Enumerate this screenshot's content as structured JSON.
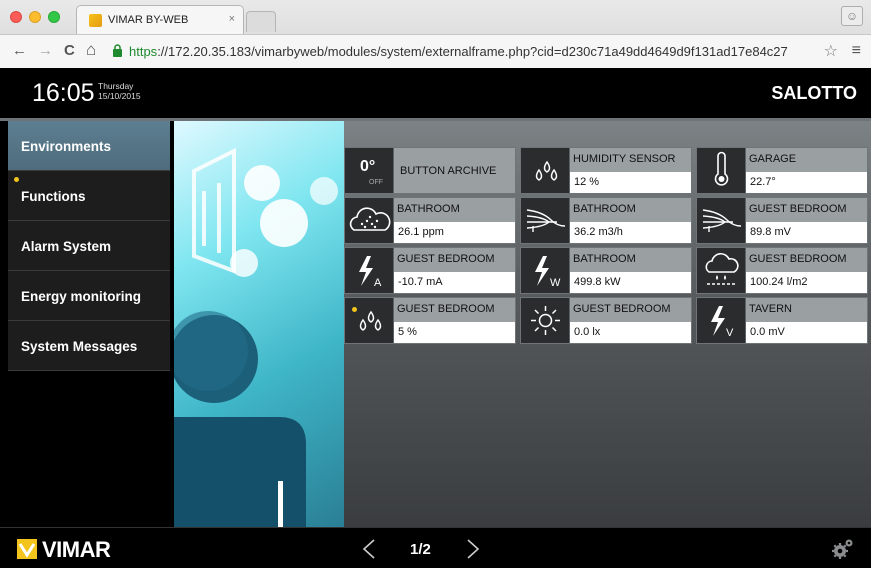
{
  "browser": {
    "tab_title": "VIMAR BY-WEB",
    "tab_close": "×",
    "url_scheme": "https",
    "url_rest": "://172.20.35.183/vimarbyweb/modules/system/externalframe.php?cid=d230c71a49dd4649d9f131ad17e84c27",
    "back": "←",
    "forward": "→",
    "reload": "C",
    "home": "⌂",
    "star": "☆",
    "menu": "≡"
  },
  "header": {
    "time": "16:05",
    "weekday": "Thursday",
    "date": "15/10/2015",
    "room": "SALOTTO"
  },
  "sidebar": {
    "items": [
      {
        "label": "Environments",
        "active": true
      },
      {
        "label": "Functions",
        "dot": true
      },
      {
        "label": "Alarm System"
      },
      {
        "label": "Energy monitoring"
      },
      {
        "label": "System Messages"
      }
    ]
  },
  "tiles": [
    {
      "type": "button",
      "deg": "0°",
      "off": "OFF",
      "label": "BUTTON ARCHIVE",
      "icon": "button-archive-icon"
    },
    {
      "name": "HUMIDITY SENSOR",
      "value": "12 %",
      "icon": "humidity-icon"
    },
    {
      "name": "GARAGE",
      "value": "22.7°",
      "icon": "thermometer-icon"
    },
    {
      "name": "BATHROOM",
      "value": "26.1 ppm",
      "icon": "air-quality-icon"
    },
    {
      "name": "BATHROOM",
      "value": "36.2 m3/h",
      "icon": "airflow-icon"
    },
    {
      "name": "GUEST BEDROOM",
      "value": "89.8 mV",
      "icon": "airflow-icon"
    },
    {
      "name": "GUEST BEDROOM",
      "value": "-10.7 mA",
      "icon": "current-icon"
    },
    {
      "name": "BATHROOM",
      "value": "499.8 kW",
      "icon": "power-icon"
    },
    {
      "name": "GUEST BEDROOM",
      "value": "100.24 l/m2",
      "icon": "rain-icon"
    },
    {
      "name": "GUEST BEDROOM",
      "value": "5 %",
      "icon": "humidity-icon",
      "dot": true
    },
    {
      "name": "GUEST BEDROOM",
      "value": "0.0 lx",
      "icon": "light-sensor-icon"
    },
    {
      "name": "TAVERN",
      "value": "0.0 mV",
      "icon": "voltage-icon"
    }
  ],
  "footer": {
    "logo": "VIMAR",
    "page": "1/2"
  },
  "colors": {
    "active_menu": "#587888",
    "notify_dot": "#f3c41b",
    "https_green": "#1f8a2e"
  }
}
